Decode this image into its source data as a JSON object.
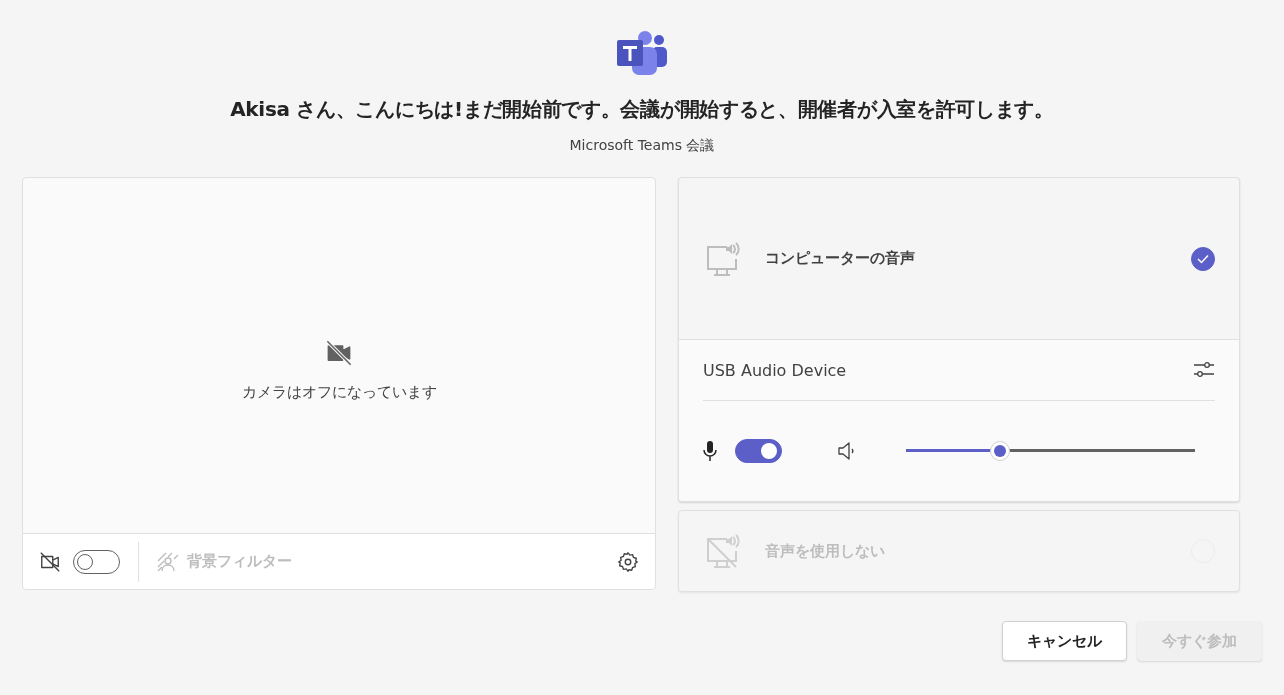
{
  "heading": "Akisa さん、こんにちは!まだ開始前です。会議が開始すると、開催者が入室を許可します。",
  "subtitle": "Microsoft Teams 会議",
  "video": {
    "status_text": "カメラはオフになっています",
    "camera_on": false,
    "background_filter": {
      "label": "背景フィルター",
      "disabled": true
    }
  },
  "audio_options": [
    {
      "kind": "computer",
      "label": "コンピューターの音声",
      "selected": true,
      "disabled": false,
      "device": "USB Audio Device",
      "mic_on": true,
      "volume": {
        "level": 0.325
      }
    },
    {
      "kind": "none",
      "label": "音声を使用しない",
      "selected": false,
      "disabled": true
    }
  ],
  "buttons": [
    {
      "label": "キャンセル",
      "disabled": false
    },
    {
      "label": "今すぐ参加",
      "disabled": true
    }
  ]
}
